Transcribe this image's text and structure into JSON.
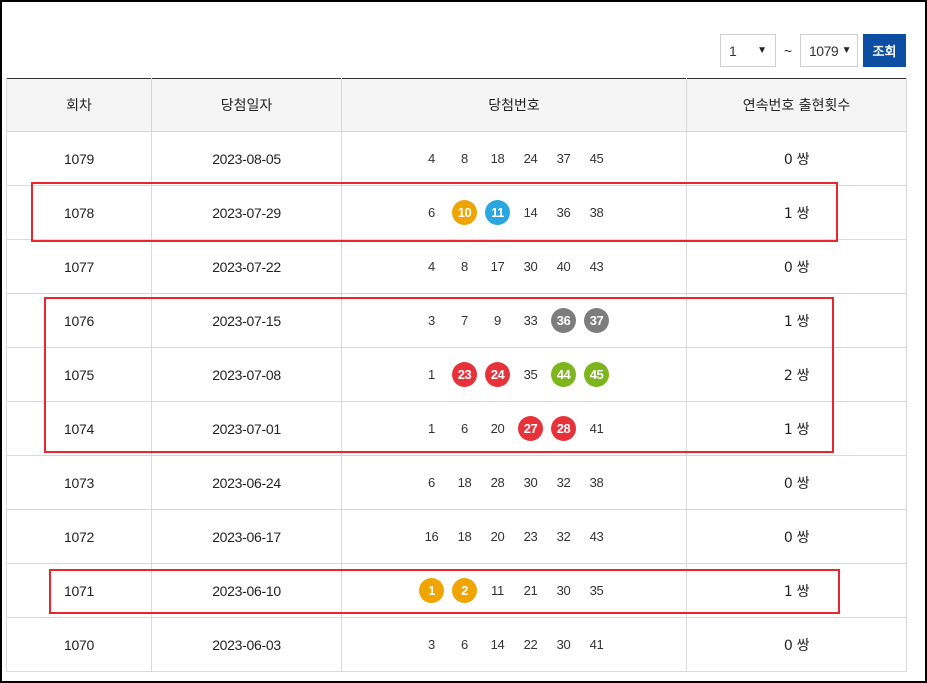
{
  "filter": {
    "from_value": "1",
    "tilde": "~",
    "to_value": "1079",
    "search_label": "조회"
  },
  "table": {
    "headers": [
      "회차",
      "당첨일자",
      "당첨번호",
      "연속번호 출현횟수"
    ],
    "rows": [
      {
        "round": "1079",
        "date": "2023-08-05",
        "numbers": [
          {
            "n": "4"
          },
          {
            "n": "8"
          },
          {
            "n": "18"
          },
          {
            "n": "24"
          },
          {
            "n": "37"
          },
          {
            "n": "45"
          }
        ],
        "count": "0 쌍"
      },
      {
        "round": "1078",
        "date": "2023-07-29",
        "numbers": [
          {
            "n": "6"
          },
          {
            "n": "10",
            "color": "#f0a400"
          },
          {
            "n": "11",
            "color": "#2aa6e0"
          },
          {
            "n": "14"
          },
          {
            "n": "36"
          },
          {
            "n": "38"
          }
        ],
        "count": "1 쌍"
      },
      {
        "round": "1077",
        "date": "2023-07-22",
        "numbers": [
          {
            "n": "4"
          },
          {
            "n": "8"
          },
          {
            "n": "17"
          },
          {
            "n": "30"
          },
          {
            "n": "40"
          },
          {
            "n": "43"
          }
        ],
        "count": "0 쌍"
      },
      {
        "round": "1076",
        "date": "2023-07-15",
        "numbers": [
          {
            "n": "3"
          },
          {
            "n": "7"
          },
          {
            "n": "9"
          },
          {
            "n": "33"
          },
          {
            "n": "36",
            "color": "#7d7d7d"
          },
          {
            "n": "37",
            "color": "#7d7d7d"
          }
        ],
        "count": "1 쌍"
      },
      {
        "round": "1075",
        "date": "2023-07-08",
        "numbers": [
          {
            "n": "1"
          },
          {
            "n": "23",
            "color": "#e8323a"
          },
          {
            "n": "24",
            "color": "#e8323a"
          },
          {
            "n": "35"
          },
          {
            "n": "44",
            "color": "#7cb51c"
          },
          {
            "n": "45",
            "color": "#7cb51c"
          }
        ],
        "count": "2 쌍"
      },
      {
        "round": "1074",
        "date": "2023-07-01",
        "numbers": [
          {
            "n": "1"
          },
          {
            "n": "6"
          },
          {
            "n": "20"
          },
          {
            "n": "27",
            "color": "#e8323a"
          },
          {
            "n": "28",
            "color": "#e8323a"
          },
          {
            "n": "41"
          }
        ],
        "count": "1 쌍"
      },
      {
        "round": "1073",
        "date": "2023-06-24",
        "numbers": [
          {
            "n": "6"
          },
          {
            "n": "18"
          },
          {
            "n": "28"
          },
          {
            "n": "30"
          },
          {
            "n": "32"
          },
          {
            "n": "38"
          }
        ],
        "count": "0 쌍"
      },
      {
        "round": "1072",
        "date": "2023-06-17",
        "numbers": [
          {
            "n": "16"
          },
          {
            "n": "18"
          },
          {
            "n": "20"
          },
          {
            "n": "23"
          },
          {
            "n": "32"
          },
          {
            "n": "43"
          }
        ],
        "count": "0 쌍"
      },
      {
        "round": "1071",
        "date": "2023-06-10",
        "numbers": [
          {
            "n": "1",
            "color": "#f0a400"
          },
          {
            "n": "2",
            "color": "#f0a400"
          },
          {
            "n": "11"
          },
          {
            "n": "21"
          },
          {
            "n": "30"
          },
          {
            "n": "35"
          }
        ],
        "count": "1 쌍"
      },
      {
        "round": "1070",
        "date": "2023-06-03",
        "numbers": [
          {
            "n": "3"
          },
          {
            "n": "6"
          },
          {
            "n": "14"
          },
          {
            "n": "22"
          },
          {
            "n": "30"
          },
          {
            "n": "41"
          }
        ],
        "count": "0 쌍"
      }
    ]
  },
  "colors": {
    "highlight_box": "#e8262b",
    "search_button": "#0b4ea2"
  }
}
